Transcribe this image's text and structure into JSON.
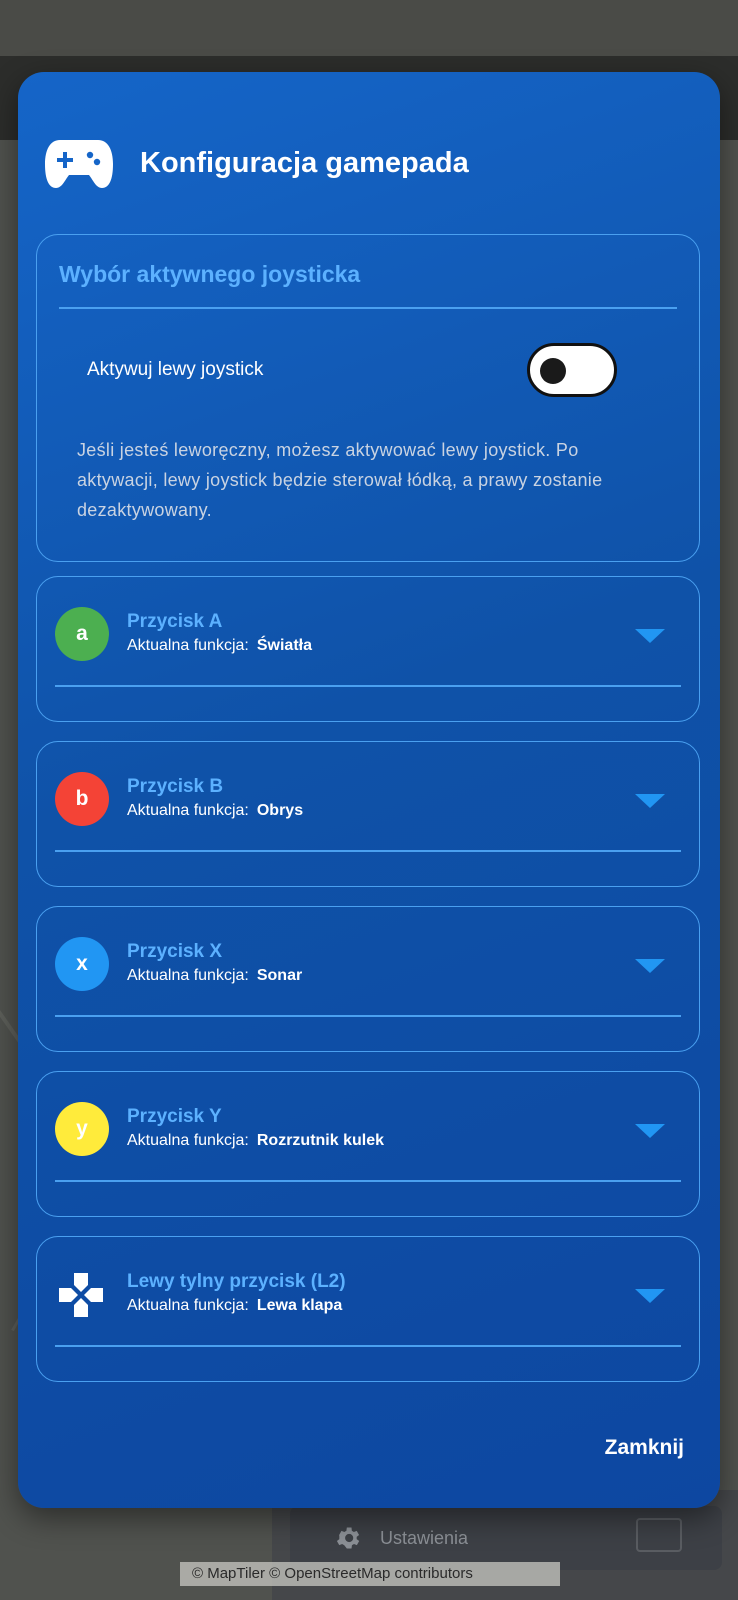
{
  "dialog": {
    "title": "Konfiguracja gamepada",
    "icon": "gamepad-icon",
    "close_label": "Zamknij"
  },
  "joystick": {
    "section_title": "Wybór aktywnego joysticka",
    "toggle_label": "Aktywuj lewy joystick",
    "toggle_on": false,
    "description": "Jeśli jesteś leworęczny, możesz aktywować lewy joystick. Po aktywacji, lewy joystick będzie sterował łódką, a prawy zostanie dezaktywowany."
  },
  "buttons": [
    {
      "letter": "a",
      "color": "#4caf50",
      "name": "Przycisk A",
      "function_prefix": "Aktualna funkcja:",
      "function": "Światła"
    },
    {
      "letter": "b",
      "color": "#f44336",
      "name": "Przycisk B",
      "function_prefix": "Aktualna funkcja:",
      "function": "Obrys"
    },
    {
      "letter": "x",
      "color": "#2196f3",
      "name": "Przycisk X",
      "function_prefix": "Aktualna funkcja:",
      "function": "Sonar"
    },
    {
      "letter": "y",
      "color": "#ffeb3b",
      "name": "Przycisk Y",
      "function_prefix": "Aktualna funkcja:",
      "function": "Rozrzutnik kulek"
    },
    {
      "icon": "dpad-icon",
      "name": "Lewy tylny przycisk (L2)",
      "function_prefix": "Aktualna funkcja:",
      "function": "Lewa klapa"
    }
  ],
  "background": {
    "settings_label": "Ustawienia",
    "attribution": "© MapTiler © OpenStreetMap contributors"
  },
  "colors": {
    "accent": "#5cb1ff",
    "border": "#4aa0f0",
    "dialog_bg": "#1565c8",
    "chevron": "#2196f3"
  }
}
